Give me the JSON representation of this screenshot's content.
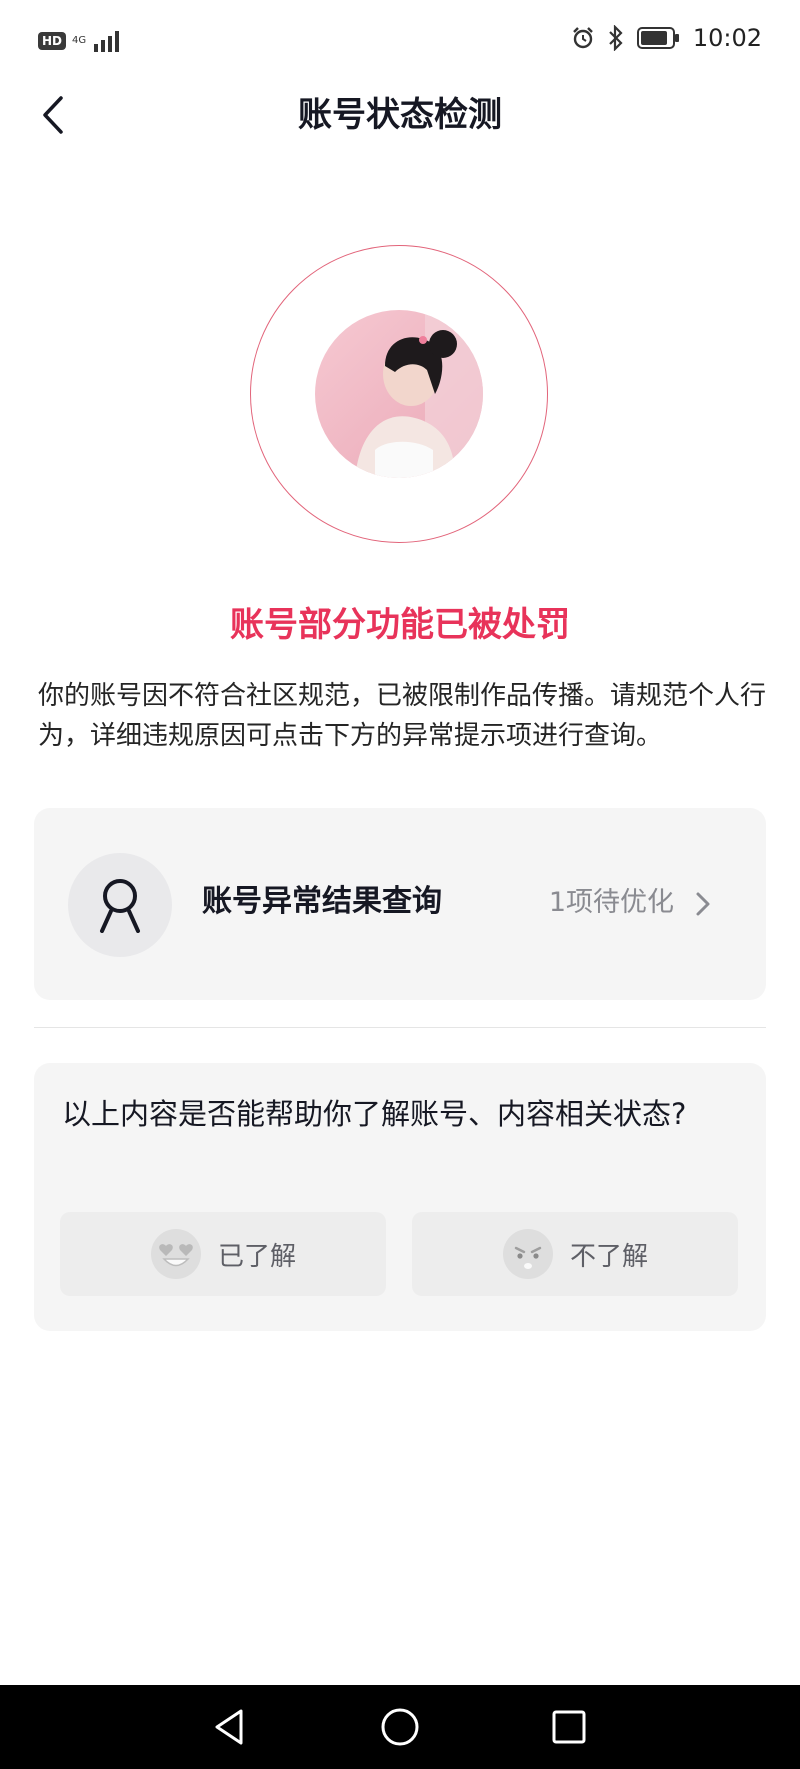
{
  "status_bar": {
    "hd_label": "HD",
    "network_label": "4G",
    "time": "10:02"
  },
  "header": {
    "title": "账号状态检测"
  },
  "penalty": {
    "title": "账号部分功能已被处罚",
    "description": "你的账号因不符合社区规范，已被限制作品传播。请规范个人行为，详细违规原因可点击下方的异常提示项进行查询。"
  },
  "result_card": {
    "label": "账号异常结果查询",
    "status": "1项待优化"
  },
  "feedback": {
    "question": "以上内容是否能帮助你了解账号、内容相关状态?",
    "yes_label": "已了解",
    "no_label": "不了解"
  },
  "colors": {
    "accent_red": "#e8335a",
    "ring_red": "#e2647a",
    "card_bg": "#f5f5f5",
    "muted_text": "#8a8b91"
  },
  "icons": {
    "back": "chevron-left-icon",
    "user": "user-outline-icon",
    "forward": "chevron-right-icon",
    "happy": "heart-eyes-emoji-icon",
    "unhappy": "sad-emoji-icon"
  }
}
